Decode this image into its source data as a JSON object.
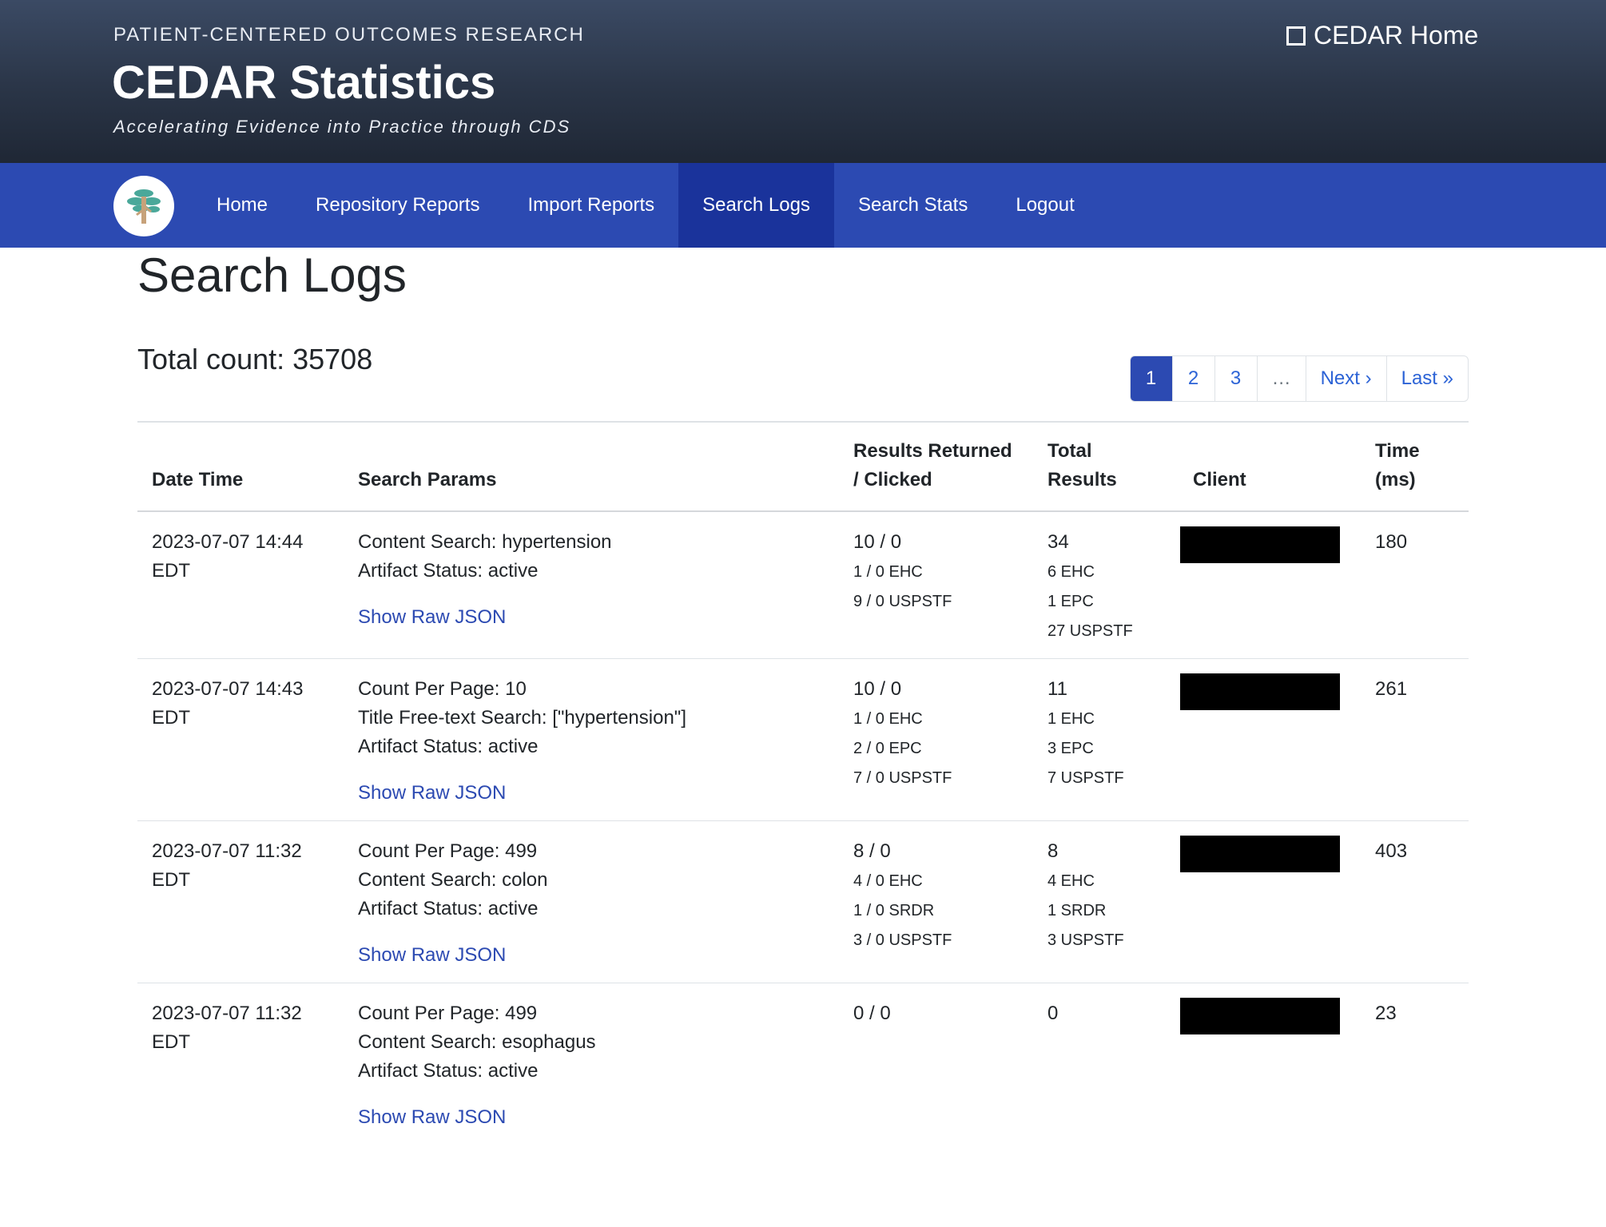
{
  "header": {
    "eyebrow": "PATIENT-CENTERED OUTCOMES RESEARCH",
    "title": "CEDAR Statistics",
    "tagline": "Accelerating Evidence into Practice through CDS",
    "home_link": "CEDAR Home"
  },
  "nav": {
    "items": [
      {
        "label": "Home"
      },
      {
        "label": "Repository Reports"
      },
      {
        "label": "Import Reports"
      },
      {
        "label": "Search Logs"
      },
      {
        "label": "Search Stats"
      },
      {
        "label": "Logout"
      }
    ],
    "active": "Search Logs"
  },
  "page": {
    "title": "Search Logs",
    "total_count": "Total count: 35708"
  },
  "pagination": {
    "pages": [
      "1",
      "2",
      "3",
      "…"
    ],
    "next": "Next ›",
    "last": "Last »"
  },
  "table": {
    "headers": {
      "date_time": "Date Time",
      "search_params": "Search Params",
      "results_line1": "Results Returned",
      "results_line2": "/ Clicked",
      "total_line1": "Total",
      "total_line2": "Results",
      "client": "Client",
      "time_line1": "Time",
      "time_line2": "(ms)"
    },
    "raw_json_label": "Show Raw JSON",
    "rows": [
      {
        "date": "2023-07-07 14:44",
        "tz": "EDT",
        "params": [
          "Content Search: hypertension",
          "Artifact Status: active"
        ],
        "returned": "10 / 0",
        "returned_breakdown": [
          "1 / 0 EHC",
          "9 / 0 USPSTF"
        ],
        "total": "34",
        "total_breakdown": [
          "6 EHC",
          "1 EPC",
          "27 USPSTF"
        ],
        "time": "180"
      },
      {
        "date": "2023-07-07 14:43",
        "tz": "EDT",
        "params": [
          "Count Per Page: 10",
          "Title Free-text Search: [\"hypertension\"]",
          "Artifact Status: active"
        ],
        "returned": "10 / 0",
        "returned_breakdown": [
          "1 / 0 EHC",
          "2 / 0 EPC",
          "7 / 0 USPSTF"
        ],
        "total": "11",
        "total_breakdown": [
          "1 EHC",
          "3 EPC",
          "7 USPSTF"
        ],
        "time": "261"
      },
      {
        "date": "2023-07-07 11:32",
        "tz": "EDT",
        "params": [
          "Count Per Page: 499",
          "Content Search: colon",
          "Artifact Status: active"
        ],
        "returned": "8 / 0",
        "returned_breakdown": [
          "4 / 0 EHC",
          "1 / 0 SRDR",
          "3 / 0 USPSTF"
        ],
        "total": "8",
        "total_breakdown": [
          "4 EHC",
          "1 SRDR",
          "3 USPSTF"
        ],
        "time": "403"
      },
      {
        "date": "2023-07-07 11:32",
        "tz": "EDT",
        "params": [
          "Count Per Page: 499",
          "Content Search: esophagus",
          "Artifact Status: active"
        ],
        "returned": "0 / 0",
        "returned_breakdown": [],
        "total": "0",
        "total_breakdown": [],
        "time": "23"
      }
    ]
  }
}
